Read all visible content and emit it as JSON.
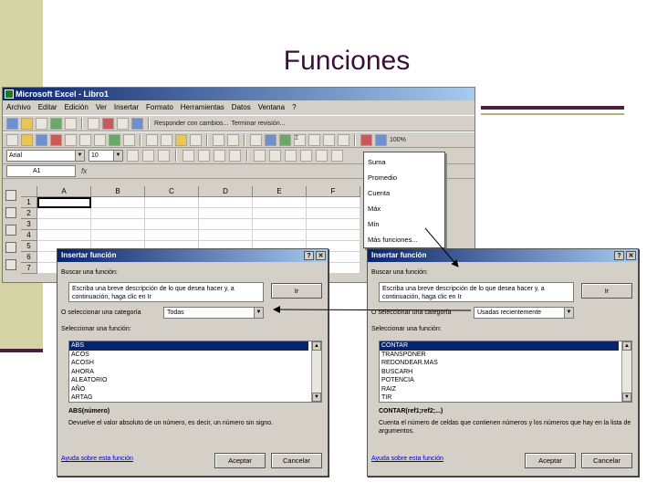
{
  "slide": {
    "title": "Funciones"
  },
  "excel": {
    "title": "Microsoft Excel - Libro1",
    "menu": [
      "Archivo",
      "Editar",
      "Edición",
      "Ver",
      "Insertar",
      "Formato",
      "Herramientas",
      "Datos",
      "Ventana",
      "?"
    ],
    "review_text": "Responder con cambios...",
    "end_review": "Terminar revisión...",
    "zoom": "100%",
    "font_name": "Arial",
    "font_size": "10",
    "name_box": "A1",
    "fx_label": "fx",
    "columns": [
      "A",
      "B",
      "C",
      "D",
      "E",
      "F"
    ],
    "rows": [
      "1",
      "2",
      "3",
      "4",
      "5",
      "6",
      "7"
    ]
  },
  "autosum_menu": {
    "items": [
      "Suma",
      "Promedio",
      "Cuenta",
      "Máx",
      "Mín",
      "Más funciones..."
    ]
  },
  "dialog_left": {
    "title": "Insertar función",
    "search_label": "Buscar una función:",
    "search_text": "Escriba una breve descripción de lo que desea hacer y, a continuación, haga clic en Ir",
    "go_button": "Ir",
    "category_label": "O seleccionar una categoría",
    "category_value": "Todas",
    "select_label": "Seleccionar una función:",
    "functions": [
      "ABS",
      "ACOS",
      "ACOSH",
      "AHORA",
      "ALEATORIO",
      "AÑO",
      "ARTAG"
    ],
    "signature": "ABS(número)",
    "description": "Devuelve el valor absoluto de un número, es decir, un número sin signo.",
    "help_link": "Ayuda sobre esta función",
    "ok_button": "Aceptar",
    "cancel_button": "Cancelar"
  },
  "dialog_right": {
    "title": "Insertar función",
    "search_label": "Buscar una función:",
    "search_text": "Escriba una breve descripción de lo que desea hacer y, a continuación, haga clic en Ir",
    "go_button": "Ir",
    "category_label": "O seleccionar una categoría",
    "category_value": "Usadas recientemente",
    "select_label": "Seleccionar una función:",
    "functions": [
      "CONTAR",
      "TRANSPONER",
      "REDONDEAR.MAS",
      "BUSCARH",
      "POTENCIA",
      "RAIZ",
      "TIR"
    ],
    "signature": "CONTAR(ref1;ref2;...)",
    "description": "Cuenta el número de celdas que contienen números y los números que hay en la lista de argumentos.",
    "help_link": "Ayuda sobre esta función",
    "ok_button": "Aceptar",
    "cancel_button": "Cancelar"
  }
}
